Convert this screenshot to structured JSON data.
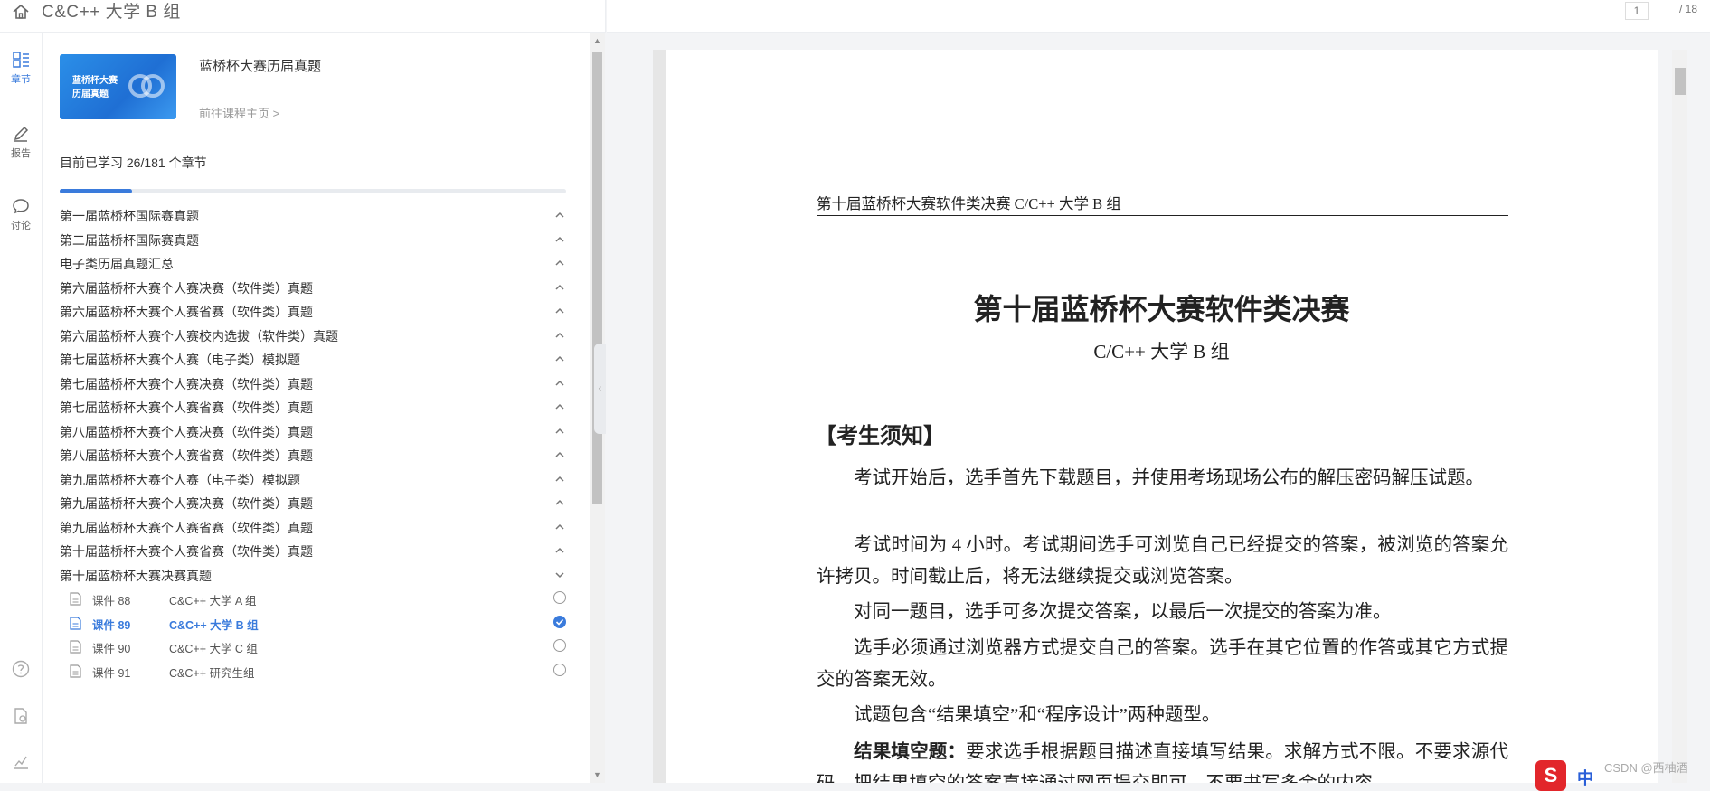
{
  "topbar": {
    "title": "C&C++ 大学 B 组"
  },
  "rail": {
    "items": [
      {
        "icon": "chapter-icon",
        "label": "章节",
        "active": true
      },
      {
        "icon": "pencil-icon",
        "label": "报告",
        "active": false
      },
      {
        "icon": "chat-icon",
        "label": "讨论",
        "active": false
      }
    ],
    "bottom_icons": [
      "help-icon",
      "file-settings-icon",
      "stats-icon"
    ]
  },
  "course": {
    "cover_text": "蓝桥杯大赛\n历届真题",
    "name": "蓝桥杯大赛历届真题",
    "link": "前往课程主页 >"
  },
  "progress": {
    "text": "目前已学习 26/181 个章节",
    "done": 26,
    "total": 181
  },
  "chapters": [
    {
      "label": "第一届蓝桥杯国际赛真题",
      "expanded": false
    },
    {
      "label": "第二届蓝桥杯国际赛真题",
      "expanded": false
    },
    {
      "label": "电子类历届真题汇总",
      "expanded": false
    },
    {
      "label": "第六届蓝桥杯大赛个人赛决赛（软件类）真题",
      "expanded": false
    },
    {
      "label": "第六届蓝桥杯大赛个人赛省赛（软件类）真题",
      "expanded": false
    },
    {
      "label": "第六届蓝桥杯大赛个人赛校内选拔（软件类）真题",
      "expanded": false
    },
    {
      "label": "第七届蓝桥杯大赛个人赛（电子类）模拟题",
      "expanded": false
    },
    {
      "label": "第七届蓝桥杯大赛个人赛决赛（软件类）真题",
      "expanded": false
    },
    {
      "label": "第七届蓝桥杯大赛个人赛省赛（软件类）真题",
      "expanded": false
    },
    {
      "label": "第八届蓝桥杯大赛个人赛决赛（软件类）真题",
      "expanded": false
    },
    {
      "label": "第八届蓝桥杯大赛个人赛省赛（软件类）真题",
      "expanded": false
    },
    {
      "label": "第九届蓝桥杯大赛个人赛（电子类）模拟题",
      "expanded": false
    },
    {
      "label": "第九届蓝桥杯大赛个人赛决赛（软件类）真题",
      "expanded": false
    },
    {
      "label": "第九届蓝桥杯大赛个人赛省赛（软件类）真题",
      "expanded": false
    },
    {
      "label": "第十届蓝桥杯大赛个人赛省赛（软件类）真题",
      "expanded": false
    },
    {
      "label": "第十届蓝桥杯大赛决赛真题",
      "expanded": true
    }
  ],
  "lessons": [
    {
      "num": "课件 88",
      "title": "C&C++ 大学 A 组",
      "active": false,
      "done": false
    },
    {
      "num": "课件 89",
      "title": "C&C++ 大学 B 组",
      "active": true,
      "done": true
    },
    {
      "num": "课件 90",
      "title": "C&C++ 大学 C 组",
      "active": false,
      "done": false
    },
    {
      "num": "课件 91",
      "title": "C&C++ 研究生组",
      "active": false,
      "done": false
    }
  ],
  "pdf_toolbar": {
    "current_page": "1",
    "total_pages": "/ 18"
  },
  "pdf": {
    "header": "第十届蓝桥杯大赛软件类决赛 C/C++ 大学 B 组",
    "title": "第十届蓝桥杯大赛软件类决赛",
    "subtitle": "C/C++ 大学 B 组",
    "section": "【考生须知】",
    "paragraphs": [
      "考试开始后，选手首先下载题目，并使用考场现场公布的解压密码解压试题。",
      "考试时间为 4 小时。考试期间选手可浏览自己已经提交的答案，被浏览的答案允许拷贝。时间截止后，将无法继续提交或浏览答案。",
      "对同一题目，选手可多次提交答案，以最后一次提交的答案为准。",
      "选手必须通过浏览器方式提交自己的答案。选手在其它位置的作答或其它方式提交的答案无效。",
      "试题包含“结果填空”和“程序设计”两种题型。"
    ],
    "last_para_bold": "结果填空题：",
    "last_para_rest": "要求选手根据题目描述直接填写结果。求解方式不限。不要求源代码，把结果填空的答案直接通过网页提交即可，不要书写多余的内容。"
  },
  "watermark": "CSDN @西柚酒",
  "tray": {
    "logo": "S",
    "ime": "中"
  },
  "colors": {
    "accent": "#3a7bdc",
    "cover": "#1f6fd4"
  }
}
